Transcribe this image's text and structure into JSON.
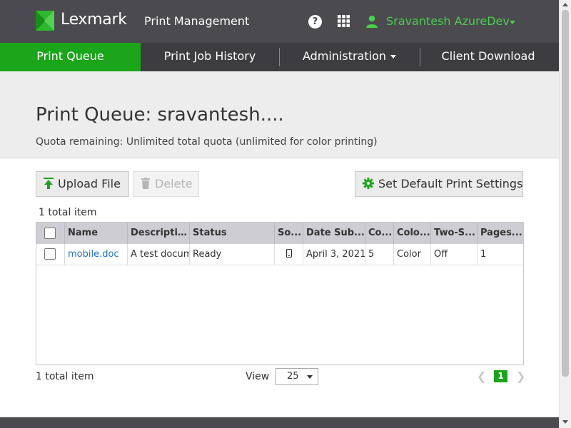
{
  "header": {
    "brand": "Lexmark",
    "product": "Print Management",
    "user_name": "Sravantesh AzureDev",
    "icons": [
      "lexmark-logo-icon",
      "help-icon",
      "apps-grid-icon",
      "user-icon",
      "chevron-down-icon"
    ]
  },
  "nav": {
    "items": [
      {
        "label": "Print Queue",
        "active": true
      },
      {
        "label": "Print Job History",
        "active": false
      },
      {
        "label": "Administration",
        "active": false
      },
      {
        "label": "Client Download",
        "active": false
      }
    ]
  },
  "page": {
    "title": "Print Queue: sravantesh....",
    "quota": "Quota remaining: Unlimited total quota (unlimited for color printing)"
  },
  "toolbar": {
    "upload_label": "Upload File",
    "delete_label": "Delete",
    "settings_label": "Set Default Print Settings"
  },
  "table": {
    "total_top": "1 total item",
    "columns": [
      "Name",
      "Description",
      "Status",
      "So...",
      "Date Sub...",
      "Co...",
      "Colo...",
      "Two-S...",
      "Pages..."
    ],
    "rows": [
      {
        "name": "mobile.doc",
        "description": "A test docum",
        "status": "Ready",
        "source_icon": "mobile-phone-icon",
        "date": "April 3, 2021",
        "copies": "5",
        "color": "Color",
        "two_sided": "Off",
        "pages": "1"
      }
    ]
  },
  "footer": {
    "total_bottom": "1 total item",
    "view_label": "View",
    "page_size": "25",
    "current_page": "1"
  },
  "colors": {
    "accent_green": "#1aa51a",
    "user_green": "#4cd04c",
    "topbar": "#4a4a4f",
    "link_blue": "#1f6fc5"
  }
}
